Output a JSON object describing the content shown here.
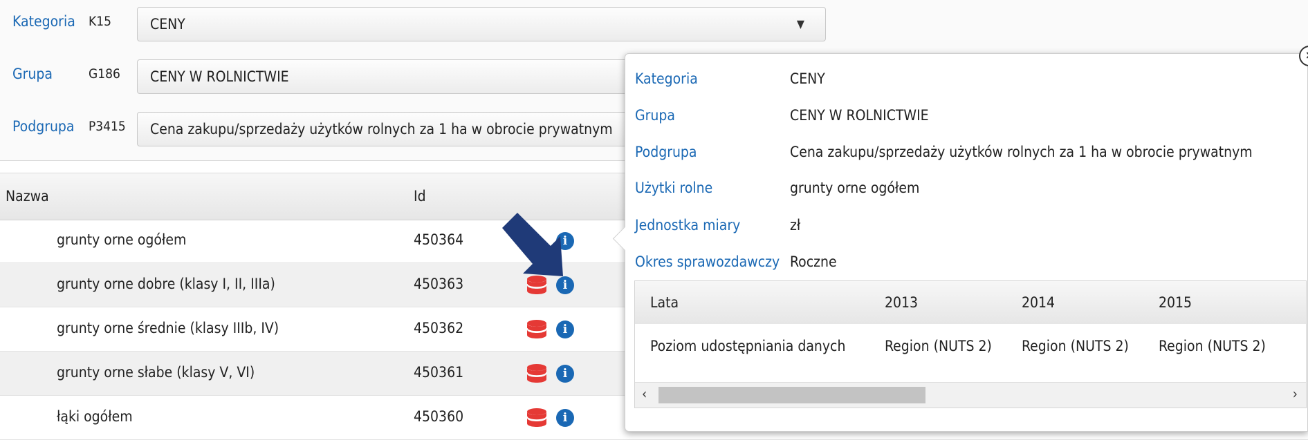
{
  "filters": {
    "kategoria": {
      "label": "Kategoria",
      "code": "K15",
      "value": "CENY"
    },
    "grupa": {
      "label": "Grupa",
      "code": "G186",
      "value": "CENY W ROLNICTWIE"
    },
    "podgrupa": {
      "label": "Podgrupa",
      "code": "P3415",
      "value": "Cena zakupu/sprzedaży użytków rolnych za 1 ha w obrocie prywatnym"
    }
  },
  "table": {
    "headers": {
      "nazwa": "Nazwa",
      "id": "Id"
    },
    "rows": [
      {
        "nazwa": "grunty orne ogółem",
        "id": "450364"
      },
      {
        "nazwa": "grunty orne dobre (klasy I, II, IIIa)",
        "id": "450363"
      },
      {
        "nazwa": "grunty orne średnie (klasy IIIb, IV)",
        "id": "450362"
      },
      {
        "nazwa": "grunty orne słabe (klasy V, VI)",
        "id": "450361"
      },
      {
        "nazwa": "łąki ogółem",
        "id": "450360"
      }
    ]
  },
  "popover": {
    "fields": [
      {
        "key": "Kategoria",
        "value": "CENY"
      },
      {
        "key": "Grupa",
        "value": "CENY W ROLNICTWIE"
      },
      {
        "key": "Podgrupa",
        "value": "Cena zakupu/sprzedaży użytków rolnych za 1 ha w obrocie prywatnym"
      },
      {
        "key": "Użytki rolne",
        "value": "grunty orne ogółem"
      },
      {
        "key": "Jednostka miary",
        "value": "zł"
      },
      {
        "key": "Okres sprawozdawczy",
        "value": "Roczne"
      }
    ],
    "years_table": {
      "header": {
        "label": "Lata",
        "years": [
          "2013",
          "2014",
          "2015"
        ]
      },
      "row": {
        "label": "Poziom udostępniania danych",
        "values": [
          "Region (NUTS 2)",
          "Region (NUTS 2)",
          "Region (NUTS 2)"
        ]
      }
    }
  },
  "icons": {
    "data": "database-icon",
    "info": "info-icon",
    "pointer": "arrow-pointer-icon",
    "close": "close-icon"
  },
  "colors": {
    "link": "#1a68b4",
    "database": "#e53935",
    "info": "#1a68b4",
    "pointer": "#1f3a78"
  }
}
